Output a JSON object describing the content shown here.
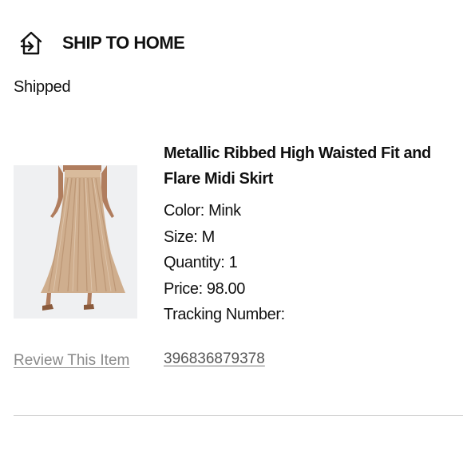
{
  "section": {
    "title": "SHIP TO HOME",
    "icon": "ship-to-home-icon"
  },
  "order": {
    "status": "Shipped"
  },
  "item": {
    "name": "Metallic Ribbed High Waisted Fit and Flare Midi Skirt",
    "image_icon": "product-photo",
    "color": "Color: Mink",
    "size": "Size: M",
    "quantity": "Quantity: 1",
    "price": "Price: 98.00",
    "tracking_label": "Tracking Number:",
    "tracking_number": "396836879378",
    "review_label": "Review This Item"
  },
  "colors": {
    "text": "#111111",
    "link_muted": "#8a8a8a",
    "divider": "#d6d6d6",
    "skirt": "#c9a889"
  }
}
